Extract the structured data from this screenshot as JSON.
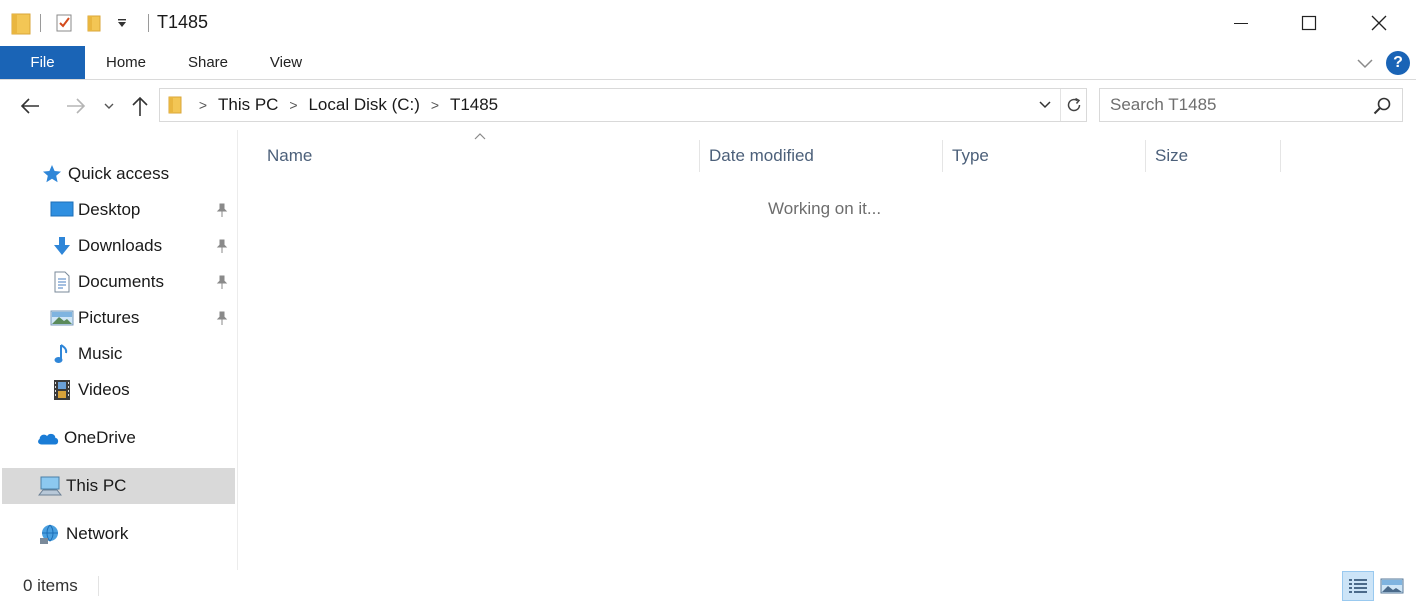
{
  "window": {
    "title": "T1485"
  },
  "ribbon": {
    "tabs": [
      "File",
      "Home",
      "Share",
      "View"
    ]
  },
  "address": {
    "crumbs": [
      "This PC",
      "Local Disk (C:)",
      "T1485"
    ]
  },
  "search": {
    "placeholder": "Search T1485"
  },
  "sidebar": {
    "items": [
      {
        "label": "Quick access",
        "icon": "star-icon"
      },
      {
        "label": "Desktop",
        "icon": "desktop-icon",
        "pinned": true
      },
      {
        "label": "Downloads",
        "icon": "download-arrow-icon",
        "pinned": true
      },
      {
        "label": "Documents",
        "icon": "document-icon",
        "pinned": true
      },
      {
        "label": "Pictures",
        "icon": "picture-icon",
        "pinned": true
      },
      {
        "label": "Music",
        "icon": "music-note-icon"
      },
      {
        "label": "Videos",
        "icon": "film-icon"
      },
      {
        "label": "OneDrive",
        "icon": "cloud-icon"
      },
      {
        "label": "This PC",
        "icon": "computer-icon",
        "selected": true
      },
      {
        "label": "Network",
        "icon": "network-icon"
      }
    ]
  },
  "content": {
    "columns": [
      "Name",
      "Date modified",
      "Type",
      "Size"
    ],
    "status_message": "Working on it..."
  },
  "statusbar": {
    "items_text": "0 items"
  },
  "colors": {
    "accent": "#1a64b6",
    "selected_bg": "#d9d9d9",
    "header_text": "#4c607a"
  }
}
